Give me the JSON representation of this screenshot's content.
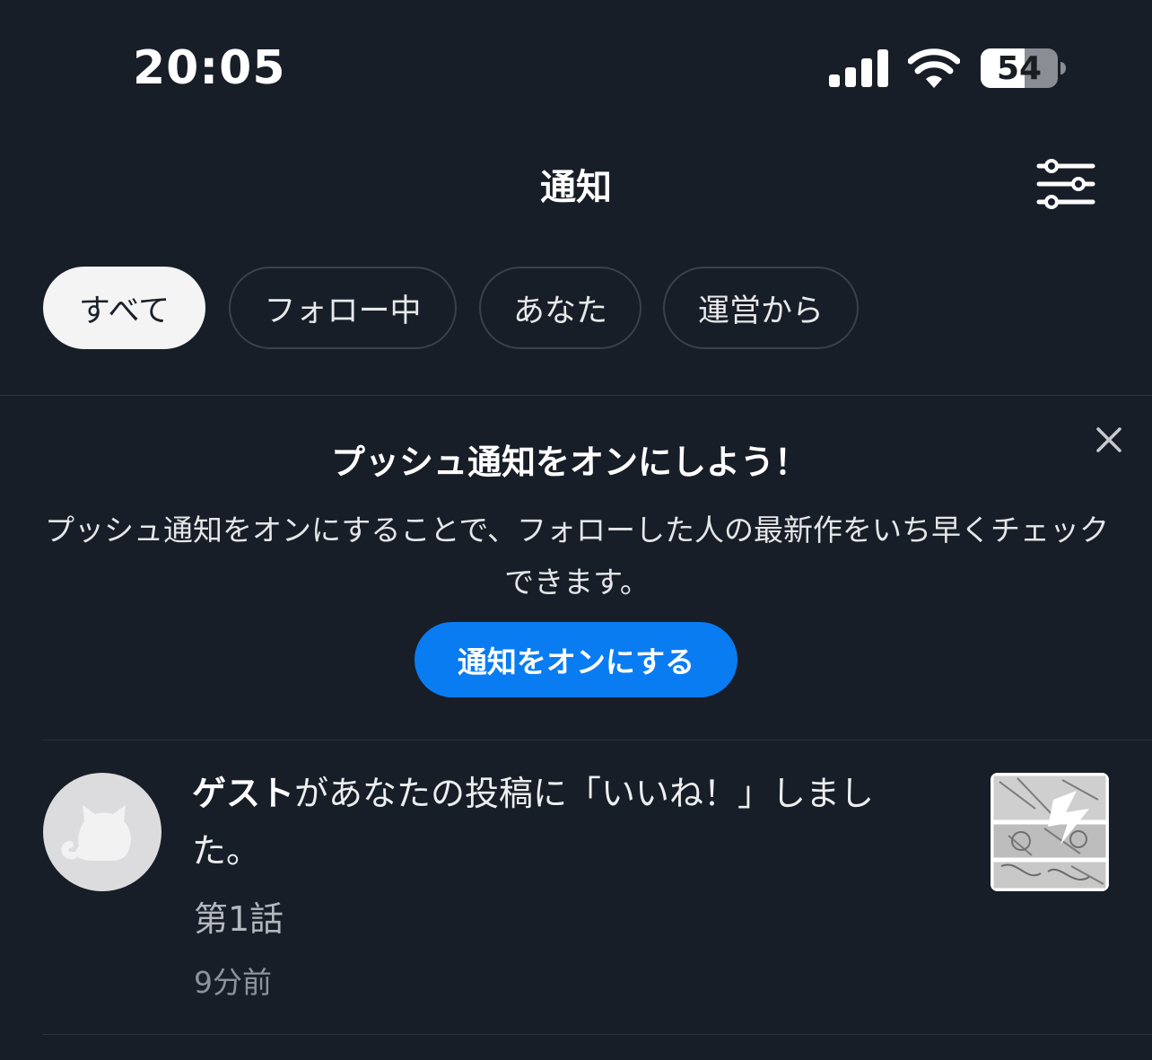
{
  "status_bar": {
    "time": "20:05",
    "battery_level": "54",
    "icons": [
      "signal-icon",
      "wifi-icon",
      "battery-icon"
    ]
  },
  "header": {
    "title": "通知",
    "filter_icon": "sliders-icon"
  },
  "tabs": [
    {
      "label": "すべて",
      "active": true
    },
    {
      "label": "フォロー中",
      "active": false
    },
    {
      "label": "あなた",
      "active": false
    },
    {
      "label": "運営から",
      "active": false
    }
  ],
  "push_banner": {
    "title": "プッシュ通知をオンにしよう！",
    "body": "プッシュ通知をオンにすることで、フォローした人の最新作をいち早くチェックできます。",
    "button_label": "通知をオンにする",
    "close_icon": "close-icon"
  },
  "notifications": [
    {
      "user": "ゲスト",
      "message": "があなたの投稿に「いいね！」しました。",
      "work_title": "第1話",
      "time": "9分前",
      "avatar_icon": "cat-avatar-icon"
    }
  ],
  "colors": {
    "background": "#181e27",
    "accent": "#0a7cf2",
    "active_tab_bg": "#f4f4f5",
    "tab_border": "#3b414b",
    "divider": "#2e343d"
  }
}
